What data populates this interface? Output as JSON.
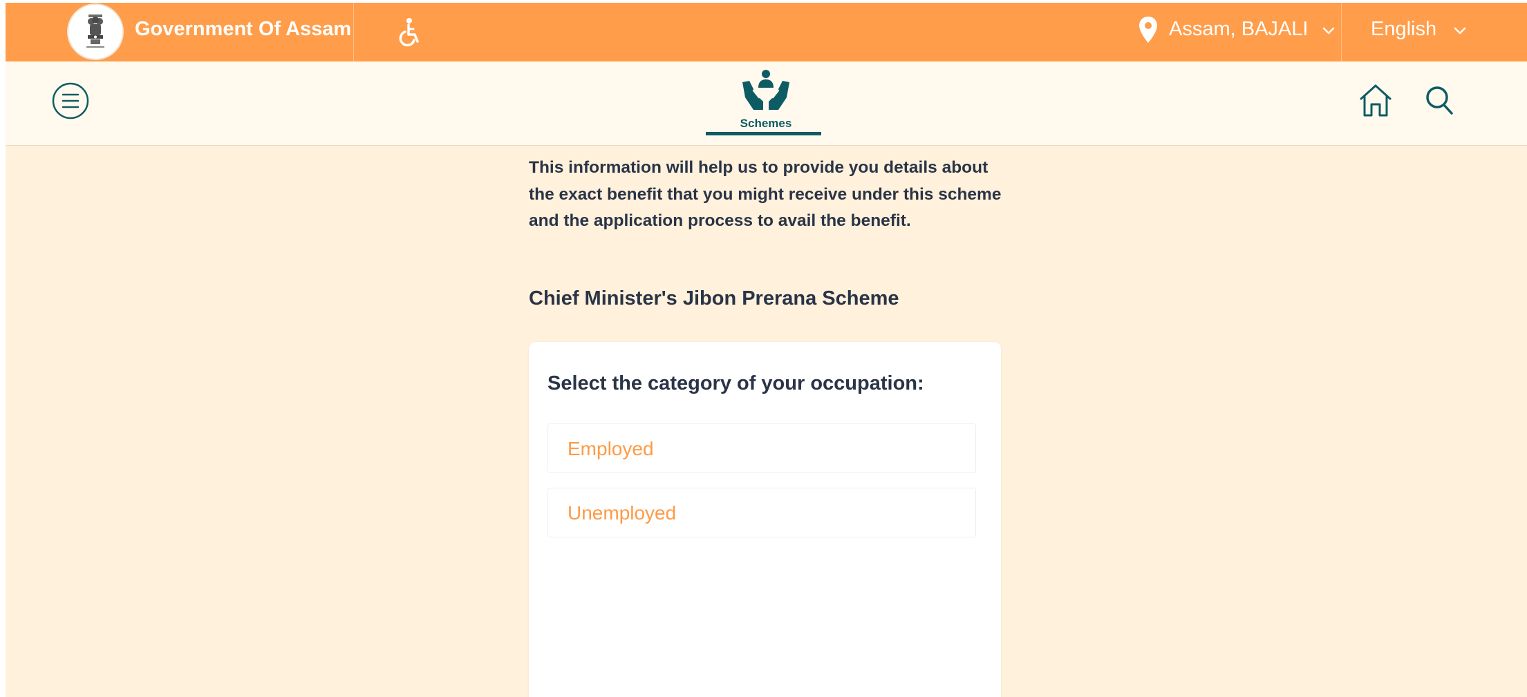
{
  "colors": {
    "topbar": "#ff9d4a",
    "navbar": "#fff9ee",
    "page_background": "#fff1dc",
    "teal": "#0d5c63",
    "text": "#2a3446",
    "option_text": "#ff9a44"
  },
  "topbar": {
    "title": "Government Of Assam",
    "emblem_icon": "state-emblem-icon",
    "accessibility_icon": "wheelchair-icon",
    "location_icon": "map-pin-icon",
    "location": "Assam, BAJALI",
    "language": "English"
  },
  "navbar": {
    "menu_icon": "hamburger-menu-icon",
    "section_label": "Schemes",
    "home_icon": "home-icon",
    "search_icon": "search-icon"
  },
  "content": {
    "info_text": "This information will help us to provide you details about the exact benefit that you might receive under this scheme and the application process to avail the benefit.",
    "scheme_name": "Chief Minister's Jibon Prerana Scheme",
    "question": "Select the category of your occupation:",
    "options": [
      {
        "label": "Employed"
      },
      {
        "label": "Unemployed"
      }
    ]
  }
}
